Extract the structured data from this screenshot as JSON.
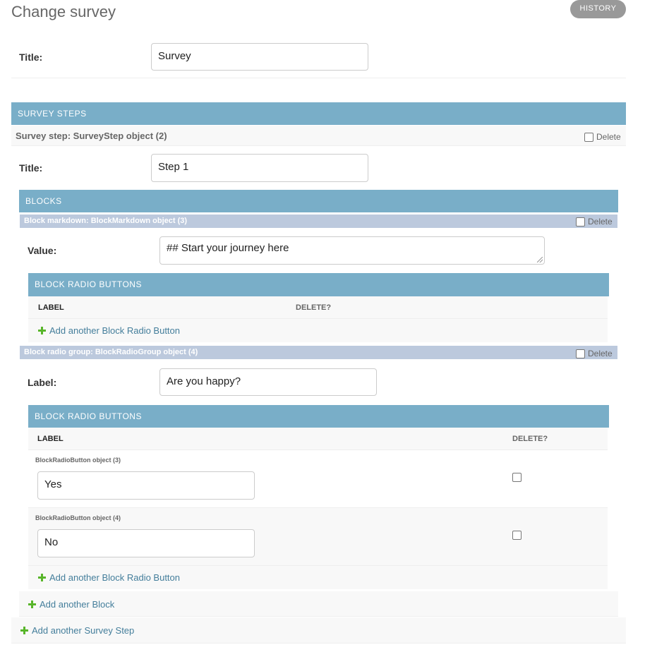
{
  "page": {
    "title": "Change survey",
    "history_label": "HISTORY"
  },
  "survey": {
    "title_label": "Title:",
    "title_value": "Survey"
  },
  "survey_steps": {
    "header": "SURVEY STEPS",
    "step_label": "Survey step: SurveyStep object (2)",
    "delete_label": "Delete",
    "title_label": "Title:",
    "title_value": "Step 1",
    "add_step_label": "Add another Survey Step"
  },
  "blocks": {
    "header": "BLOCKS",
    "add_block_label": "Add another Block",
    "markdown": {
      "bar_label": "Block markdown: BlockMarkdown object (3)",
      "delete_label": "Delete",
      "value_label": "Value:",
      "value": "## Start your journey here",
      "radio_buttons": {
        "header": "BLOCK RADIO BUTTONS",
        "col_label": "LABEL",
        "col_delete": "DELETE?",
        "add_label": "Add another Block Radio Button"
      }
    },
    "radio_group": {
      "bar_label": "Block radio group: BlockRadioGroup object (4)",
      "delete_label": "Delete",
      "label_label": "Label:",
      "label_value": "Are you happy?",
      "radio_buttons": {
        "header": "BLOCK RADIO BUTTONS",
        "col_label": "LABEL",
        "col_delete": "DELETE?",
        "rows": [
          {
            "object": "BlockRadioButton object (3)",
            "label": "Yes"
          },
          {
            "object": "BlockRadioButton object (4)",
            "label": "No"
          }
        ],
        "add_label": "Add another Block Radio Button"
      }
    }
  },
  "colors": {
    "module_header": "#79aec8",
    "inline_bar": "#bcc9dd",
    "link": "#447e9b",
    "add_icon": "#58b52a"
  }
}
